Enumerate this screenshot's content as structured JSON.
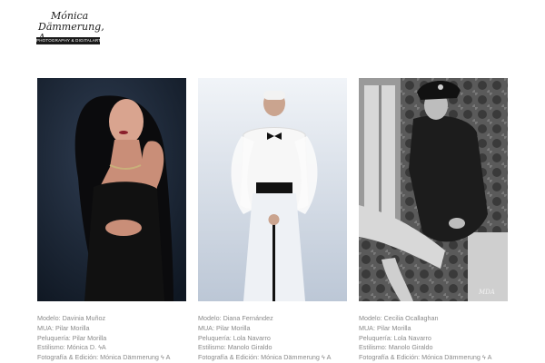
{
  "logo": {
    "script_line1": "Mónica",
    "script_line2": "Dämmerung, A",
    "bar_text": "PHOTOGRAPHY & DIGITALART"
  },
  "gallery": [
    {
      "credits": [
        "Modelo: Davinia Muñoz",
        "MUA: Pilar Morilla",
        "Peluquería: Pilar Morilla",
        "Estilismo: Mónica D. ϟA",
        "Fotografía & Edición: Mónica Dämmerung ϟ A"
      ]
    },
    {
      "credits": [
        "Modelo: Diana Fernández",
        "MUA: Pilar Morilla",
        "Peluquería: Lola Navarro",
        "Estilismo: Manolo Giraldo",
        "Fotografía & Edición: Mónica Dämmerung ϟ A"
      ]
    },
    {
      "credits": [
        "Modelo: Cecilia Ocallaghan",
        "MUA: Pilar Morilla",
        "Peluquería: Lola Navarro",
        "Estilismo: Manolo Giraldo",
        "Fotografía & Edición: Mónica Dämmerung ϟ A"
      ]
    }
  ]
}
